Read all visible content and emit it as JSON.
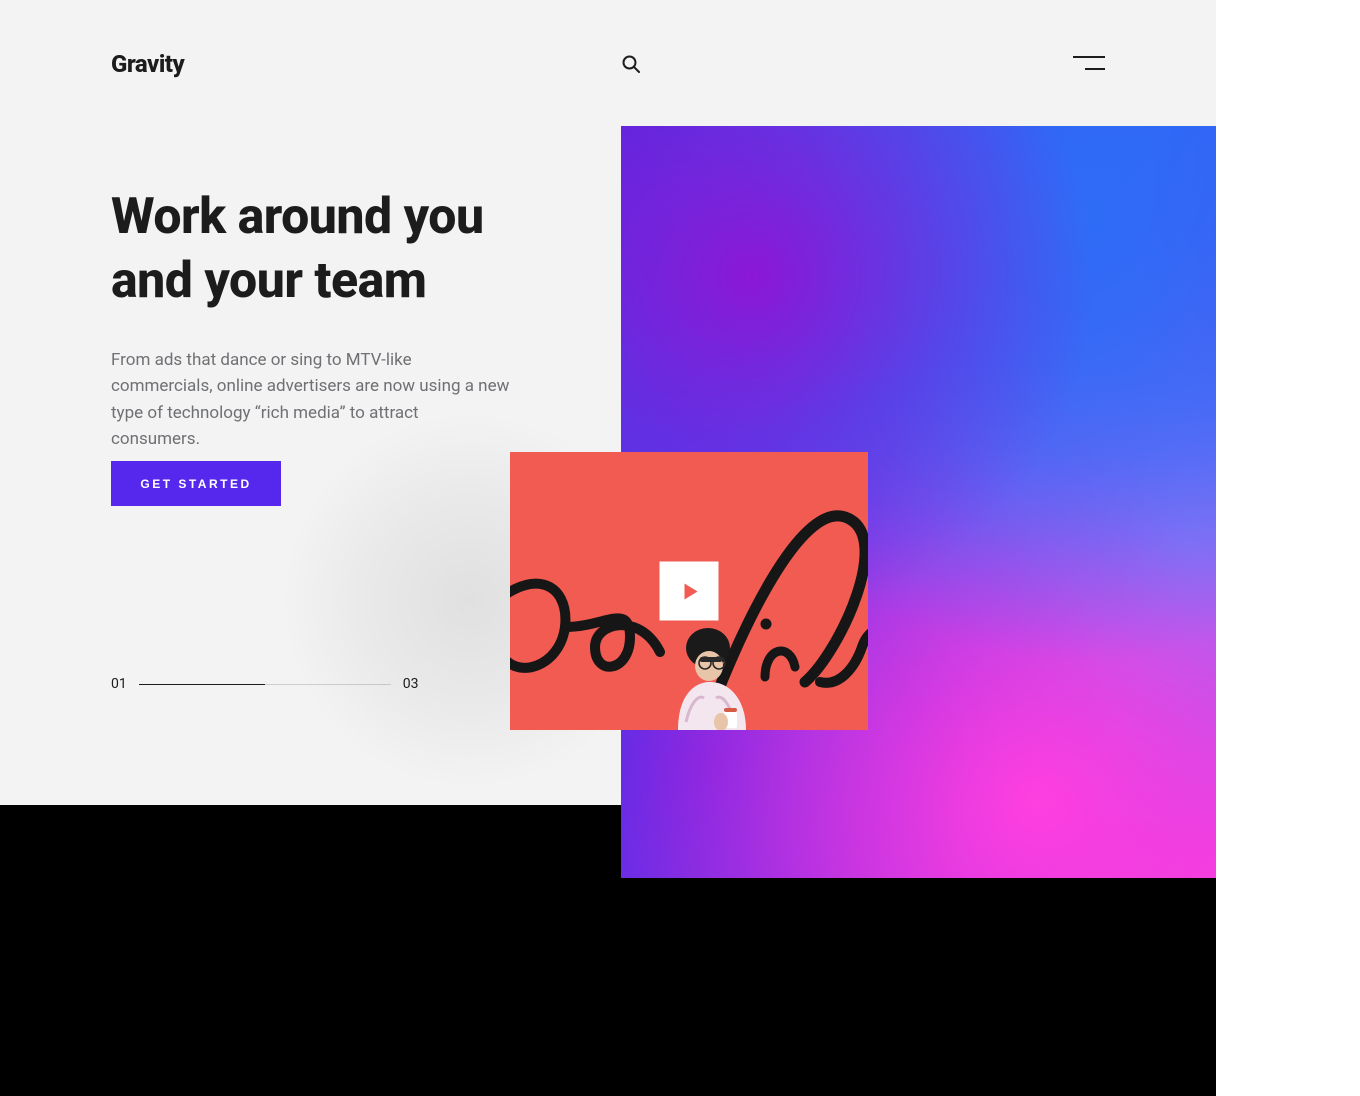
{
  "brand": {
    "name": "Gravity"
  },
  "hero": {
    "headline": "Work around you and your team",
    "subtext": "From ads that dance or sing to MTV-like commercials, online advertisers are now using a new type of technology “rich media” to attract consumers.",
    "cta_label": "GET STARTED"
  },
  "pager": {
    "current": "01",
    "total": "03"
  },
  "colors": {
    "accent": "#5628ee",
    "video_bg": "#f25b52",
    "page_light": "#f3f3f3",
    "page_dark": "#000000"
  },
  "icons": {
    "search": "search-icon",
    "menu": "menu-icon",
    "play": "play-icon"
  }
}
